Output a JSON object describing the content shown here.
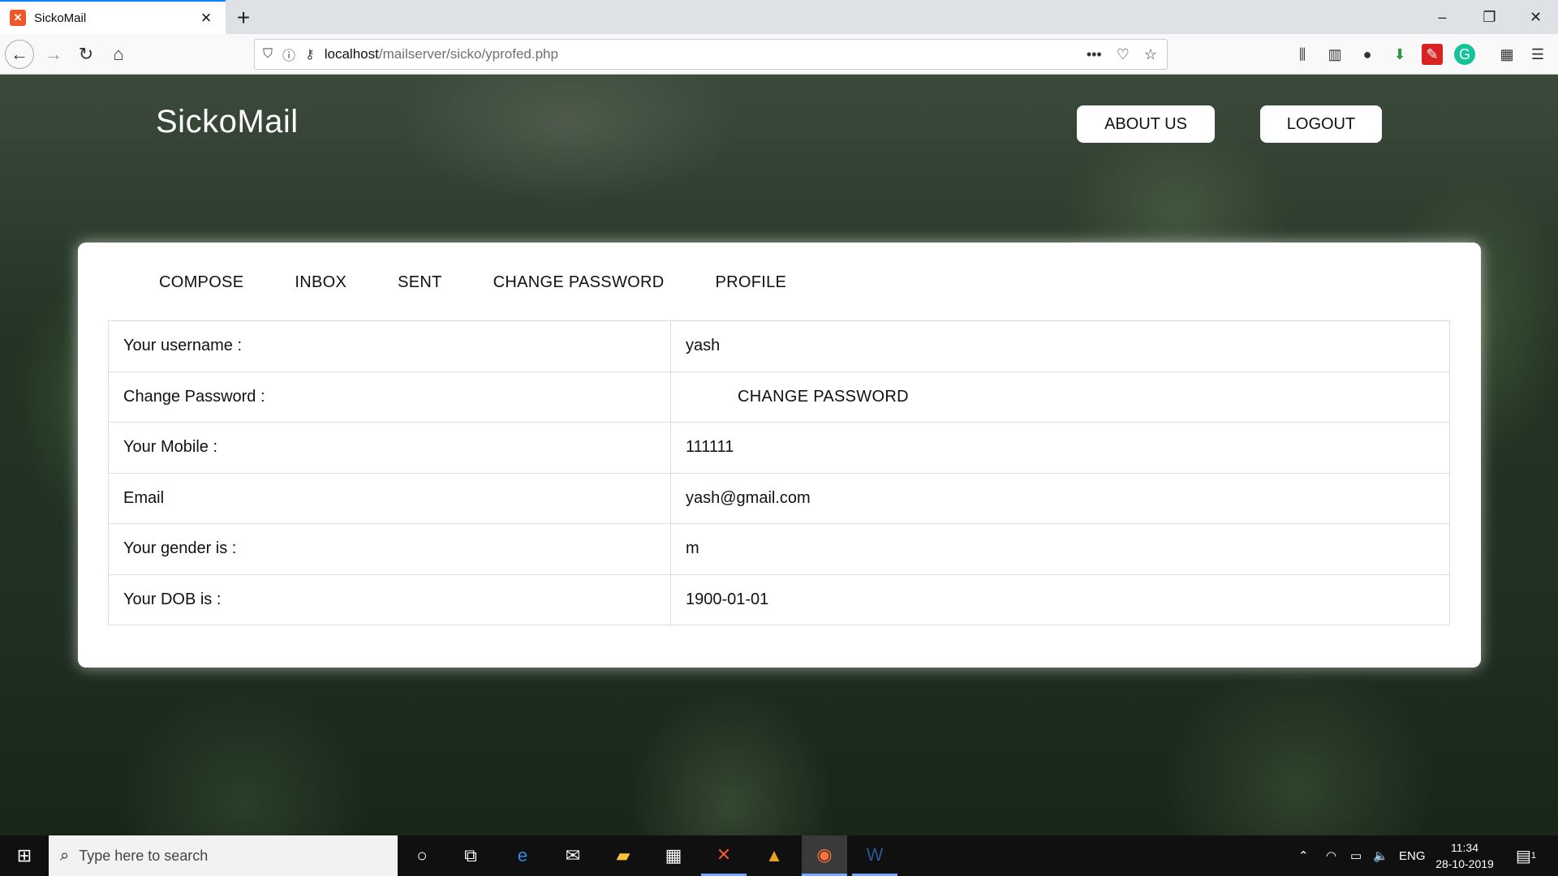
{
  "browser": {
    "tab_title": "SickoMail",
    "url_host": "localhost",
    "url_path": "/mailserver/sicko/yprofed.php"
  },
  "site": {
    "brand": "SickoMail",
    "about_label": "ABOUT US",
    "logout_label": "LOGOUT"
  },
  "menu": [
    "COMPOSE",
    "INBOX",
    "SENT",
    "CHANGE PASSWORD",
    "PROFILE"
  ],
  "profile": {
    "rows": [
      {
        "label": "Your username :",
        "value": "yash"
      },
      {
        "label": "Change Password :",
        "value": "CHANGE PASSWORD"
      },
      {
        "label": "Your Mobile :",
        "value": "111111"
      },
      {
        "label": "Email",
        "value": "yash@gmail.com"
      },
      {
        "label": "Your gender is :",
        "value": "m"
      },
      {
        "label": "Your DOB is :",
        "value": "1900-01-01"
      }
    ]
  },
  "taskbar": {
    "search_placeholder": "Type here to search",
    "lang": "ENG",
    "time": "11:34",
    "date": "28-10-2019",
    "notification_count": "1"
  },
  "colors": {
    "accent": "#0a84ff",
    "card_bg": "#ffffff",
    "taskbar_bg": "#101010"
  }
}
